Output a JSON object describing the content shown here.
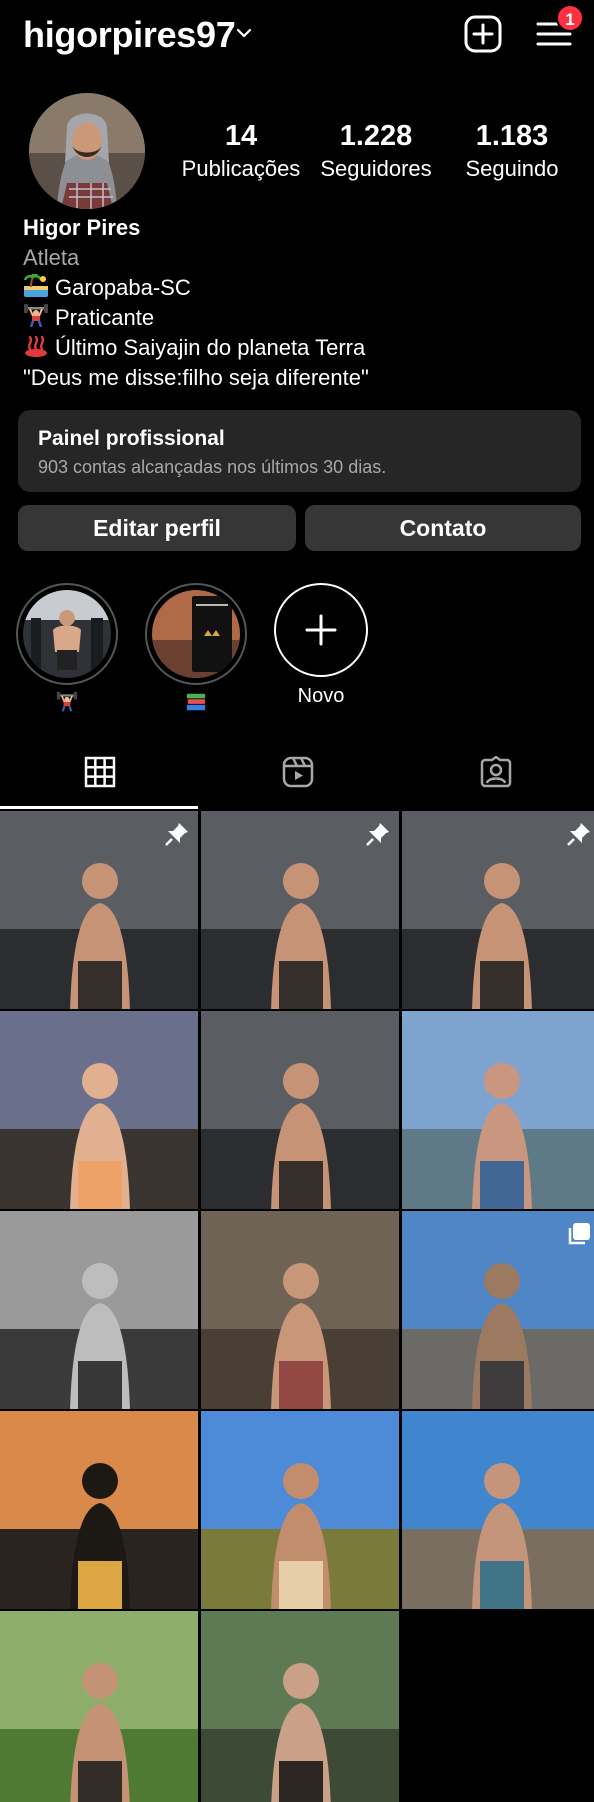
{
  "header": {
    "username": "higorpires97",
    "notification_count": "1"
  },
  "stats": [
    {
      "value": "14",
      "label": "Publicações"
    },
    {
      "value": "1.228",
      "label": "Seguidores"
    },
    {
      "value": "1.183",
      "label": "Seguindo"
    }
  ],
  "bio": {
    "name": "Higor Pires",
    "category": "Atleta",
    "lines": [
      {
        "icon": "beach-icon",
        "text": "Garopaba-SC"
      },
      {
        "icon": "weightlifter-icon",
        "text": "Praticante"
      },
      {
        "icon": "hot-springs-icon",
        "text": "Último Saiyajin do planeta Terra"
      },
      {
        "icon": "",
        "text": " \"Deus me disse:filho seja diferente\""
      }
    ]
  },
  "panel": {
    "title": "Painel profissional",
    "subtitle": "903 contas alcançadas nos últimos 30 dias."
  },
  "buttons": {
    "edit": "Editar perfil",
    "contact": "Contato"
  },
  "highlights": [
    {
      "icon": "weightlifter-icon",
      "label": ""
    },
    {
      "icon": "books-icon",
      "label": ""
    },
    {
      "icon": "plus-icon",
      "label": "Novo"
    }
  ],
  "tabs": [
    {
      "icon": "grid-icon",
      "active": true
    },
    {
      "icon": "reels-icon",
      "active": false
    },
    {
      "icon": "tagged-icon",
      "active": false
    }
  ],
  "posts": [
    {
      "scene": "gym-selfie",
      "pinned": true,
      "multi": false
    },
    {
      "scene": "gym-selfie",
      "pinned": true,
      "multi": false
    },
    {
      "scene": "gym-selfie",
      "pinned": true,
      "multi": false
    },
    {
      "scene": "sunset-sea",
      "pinned": false,
      "multi": false
    },
    {
      "scene": "gym-selfie",
      "pinned": false,
      "multi": false
    },
    {
      "scene": "lagoon",
      "pinned": false,
      "multi": false
    },
    {
      "scene": "black-white",
      "pinned": false,
      "multi": false
    },
    {
      "scene": "hood-portrait",
      "pinned": false,
      "multi": false
    },
    {
      "scene": "rocks-sky",
      "pinned": false,
      "multi": true
    },
    {
      "scene": "sunset-rocks",
      "pinned": false,
      "multi": false
    },
    {
      "scene": "dune-lagoon",
      "pinned": false,
      "multi": false
    },
    {
      "scene": "beach-rocks",
      "pinned": false,
      "multi": false
    },
    {
      "scene": "park-fishing",
      "pinned": false,
      "multi": false
    },
    {
      "scene": "garden-selfie",
      "pinned": false,
      "multi": false
    }
  ],
  "colors": {
    "background": "#000000",
    "button": "#363636",
    "panel": "#262626",
    "secondary_text": "#a8a8a8",
    "badge": "#ff3040"
  }
}
